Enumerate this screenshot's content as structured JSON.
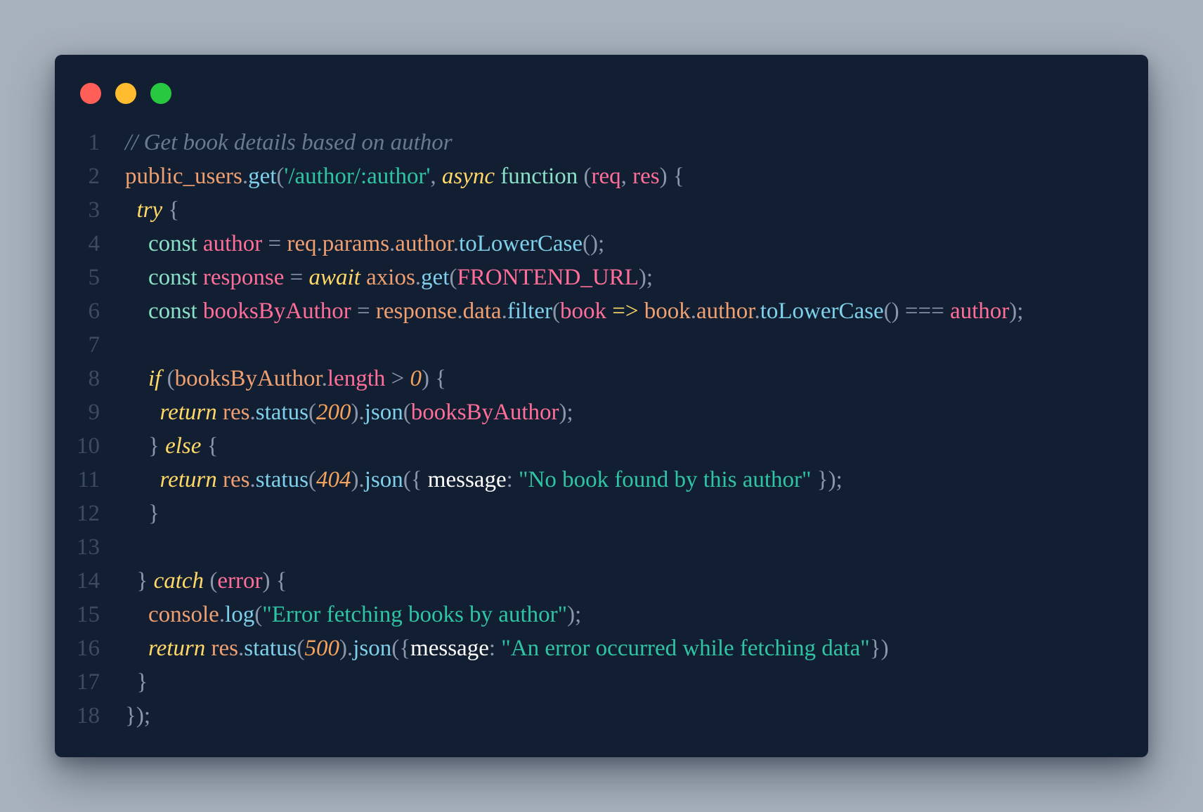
{
  "window": {
    "traffic_lights": {
      "close": "#ff5f57",
      "minimize": "#febc2e",
      "zoom": "#28c840"
    }
  },
  "colors": {
    "comment": "#6b7a90",
    "object": "#f0a070",
    "method": "#7fd0ea",
    "string": "#2fc4a8",
    "keyword": "#ffd866",
    "storage": "#8be0c8",
    "param": "#ff6e98",
    "punct": "#8a97aa",
    "number": "#f5a35c",
    "property": "#ffffff"
  },
  "code": {
    "lines": [
      {
        "n": "1",
        "tokens": [
          {
            "t": "// Get book details based on author",
            "c": "comment",
            "i": true
          }
        ]
      },
      {
        "n": "2",
        "tokens": [
          {
            "t": "public_users",
            "c": "object"
          },
          {
            "t": ".",
            "c": "punct"
          },
          {
            "t": "get",
            "c": "method"
          },
          {
            "t": "(",
            "c": "punct"
          },
          {
            "t": "'/author/:author'",
            "c": "string"
          },
          {
            "t": ", ",
            "c": "punct"
          },
          {
            "t": "async",
            "c": "keyword",
            "i": true
          },
          {
            "t": " ",
            "c": "punct"
          },
          {
            "t": "function",
            "c": "storage"
          },
          {
            "t": " (",
            "c": "punct"
          },
          {
            "t": "req",
            "c": "param"
          },
          {
            "t": ", ",
            "c": "punct"
          },
          {
            "t": "res",
            "c": "param"
          },
          {
            "t": ") {",
            "c": "punct"
          }
        ]
      },
      {
        "n": "3",
        "tokens": [
          {
            "t": "  ",
            "c": "punct"
          },
          {
            "t": "try",
            "c": "keyword",
            "i": true
          },
          {
            "t": " {",
            "c": "punct"
          }
        ]
      },
      {
        "n": "4",
        "tokens": [
          {
            "t": "    ",
            "c": "punct"
          },
          {
            "t": "const",
            "c": "storage"
          },
          {
            "t": " ",
            "c": "punct"
          },
          {
            "t": "author",
            "c": "param"
          },
          {
            "t": " = ",
            "c": "punct"
          },
          {
            "t": "req",
            "c": "object"
          },
          {
            "t": ".",
            "c": "punct"
          },
          {
            "t": "params",
            "c": "object"
          },
          {
            "t": ".",
            "c": "punct"
          },
          {
            "t": "author",
            "c": "object"
          },
          {
            "t": ".",
            "c": "punct"
          },
          {
            "t": "toLowerCase",
            "c": "method"
          },
          {
            "t": "();",
            "c": "punct"
          }
        ]
      },
      {
        "n": "5",
        "tokens": [
          {
            "t": "    ",
            "c": "punct"
          },
          {
            "t": "const",
            "c": "storage"
          },
          {
            "t": " ",
            "c": "punct"
          },
          {
            "t": "response",
            "c": "param"
          },
          {
            "t": " = ",
            "c": "punct"
          },
          {
            "t": "await",
            "c": "keyword",
            "i": true
          },
          {
            "t": " ",
            "c": "punct"
          },
          {
            "t": "axios",
            "c": "object"
          },
          {
            "t": ".",
            "c": "punct"
          },
          {
            "t": "get",
            "c": "method"
          },
          {
            "t": "(",
            "c": "punct"
          },
          {
            "t": "FRONTEND_URL",
            "c": "param"
          },
          {
            "t": ");",
            "c": "punct"
          }
        ]
      },
      {
        "n": "6",
        "tokens": [
          {
            "t": "    ",
            "c": "punct"
          },
          {
            "t": "const",
            "c": "storage"
          },
          {
            "t": " ",
            "c": "punct"
          },
          {
            "t": "booksByAuthor",
            "c": "param"
          },
          {
            "t": " = ",
            "c": "punct"
          },
          {
            "t": "response",
            "c": "object"
          },
          {
            "t": ".",
            "c": "punct"
          },
          {
            "t": "data",
            "c": "object"
          },
          {
            "t": ".",
            "c": "punct"
          },
          {
            "t": "filter",
            "c": "method"
          },
          {
            "t": "(",
            "c": "punct"
          },
          {
            "t": "book",
            "c": "param"
          },
          {
            "t": " => ",
            "c": "keyword"
          },
          {
            "t": "book",
            "c": "object"
          },
          {
            "t": ".",
            "c": "punct"
          },
          {
            "t": "author",
            "c": "object"
          },
          {
            "t": ".",
            "c": "punct"
          },
          {
            "t": "toLowerCase",
            "c": "method"
          },
          {
            "t": "() === ",
            "c": "punct"
          },
          {
            "t": "author",
            "c": "param"
          },
          {
            "t": ");",
            "c": "punct"
          }
        ]
      },
      {
        "n": "7",
        "tokens": []
      },
      {
        "n": "8",
        "tokens": [
          {
            "t": "    ",
            "c": "punct"
          },
          {
            "t": "if",
            "c": "keyword",
            "i": true
          },
          {
            "t": " (",
            "c": "punct"
          },
          {
            "t": "booksByAuthor",
            "c": "object"
          },
          {
            "t": ".",
            "c": "punct"
          },
          {
            "t": "length",
            "c": "param"
          },
          {
            "t": " > ",
            "c": "punct"
          },
          {
            "t": "0",
            "c": "number",
            "i": true
          },
          {
            "t": ") {",
            "c": "punct"
          }
        ]
      },
      {
        "n": "9",
        "tokens": [
          {
            "t": "      ",
            "c": "punct"
          },
          {
            "t": "return",
            "c": "keyword",
            "i": true
          },
          {
            "t": " ",
            "c": "punct"
          },
          {
            "t": "res",
            "c": "object"
          },
          {
            "t": ".",
            "c": "punct"
          },
          {
            "t": "status",
            "c": "method"
          },
          {
            "t": "(",
            "c": "punct"
          },
          {
            "t": "200",
            "c": "number",
            "i": true
          },
          {
            "t": ").",
            "c": "punct"
          },
          {
            "t": "json",
            "c": "method"
          },
          {
            "t": "(",
            "c": "punct"
          },
          {
            "t": "booksByAuthor",
            "c": "param"
          },
          {
            "t": ");",
            "c": "punct"
          }
        ]
      },
      {
        "n": "10",
        "tokens": [
          {
            "t": "    } ",
            "c": "punct"
          },
          {
            "t": "else",
            "c": "keyword",
            "i": true
          },
          {
            "t": " {",
            "c": "punct"
          }
        ]
      },
      {
        "n": "11",
        "tokens": [
          {
            "t": "      ",
            "c": "punct"
          },
          {
            "t": "return",
            "c": "keyword",
            "i": true
          },
          {
            "t": " ",
            "c": "punct"
          },
          {
            "t": "res",
            "c": "object"
          },
          {
            "t": ".",
            "c": "punct"
          },
          {
            "t": "status",
            "c": "method"
          },
          {
            "t": "(",
            "c": "punct"
          },
          {
            "t": "404",
            "c": "number",
            "i": true
          },
          {
            "t": ").",
            "c": "punct"
          },
          {
            "t": "json",
            "c": "method"
          },
          {
            "t": "({ ",
            "c": "punct"
          },
          {
            "t": "message",
            "c": "property"
          },
          {
            "t": ": ",
            "c": "punct"
          },
          {
            "t": "\"No book found by this author\"",
            "c": "string"
          },
          {
            "t": " });",
            "c": "punct"
          }
        ]
      },
      {
        "n": "12",
        "tokens": [
          {
            "t": "    }",
            "c": "punct"
          }
        ]
      },
      {
        "n": "13",
        "tokens": []
      },
      {
        "n": "14",
        "tokens": [
          {
            "t": "  } ",
            "c": "punct"
          },
          {
            "t": "catch",
            "c": "keyword",
            "i": true
          },
          {
            "t": " (",
            "c": "punct"
          },
          {
            "t": "error",
            "c": "param"
          },
          {
            "t": ") {",
            "c": "punct"
          }
        ]
      },
      {
        "n": "15",
        "tokens": [
          {
            "t": "    ",
            "c": "punct"
          },
          {
            "t": "console",
            "c": "object"
          },
          {
            "t": ".",
            "c": "punct"
          },
          {
            "t": "log",
            "c": "method"
          },
          {
            "t": "(",
            "c": "punct"
          },
          {
            "t": "\"Error fetching books by author\"",
            "c": "string"
          },
          {
            "t": ");",
            "c": "punct"
          }
        ]
      },
      {
        "n": "16",
        "tokens": [
          {
            "t": "    ",
            "c": "punct"
          },
          {
            "t": "return",
            "c": "keyword",
            "i": true
          },
          {
            "t": " ",
            "c": "punct"
          },
          {
            "t": "res",
            "c": "object"
          },
          {
            "t": ".",
            "c": "punct"
          },
          {
            "t": "status",
            "c": "method"
          },
          {
            "t": "(",
            "c": "punct"
          },
          {
            "t": "500",
            "c": "number",
            "i": true
          },
          {
            "t": ").",
            "c": "punct"
          },
          {
            "t": "json",
            "c": "method"
          },
          {
            "t": "({",
            "c": "punct"
          },
          {
            "t": "message",
            "c": "property"
          },
          {
            "t": ": ",
            "c": "punct"
          },
          {
            "t": "\"An error occurred while fetching data\"",
            "c": "string"
          },
          {
            "t": "})",
            "c": "punct"
          }
        ]
      },
      {
        "n": "17",
        "tokens": [
          {
            "t": "  }",
            "c": "punct"
          }
        ]
      },
      {
        "n": "18",
        "tokens": [
          {
            "t": "});",
            "c": "punct"
          }
        ]
      }
    ]
  }
}
